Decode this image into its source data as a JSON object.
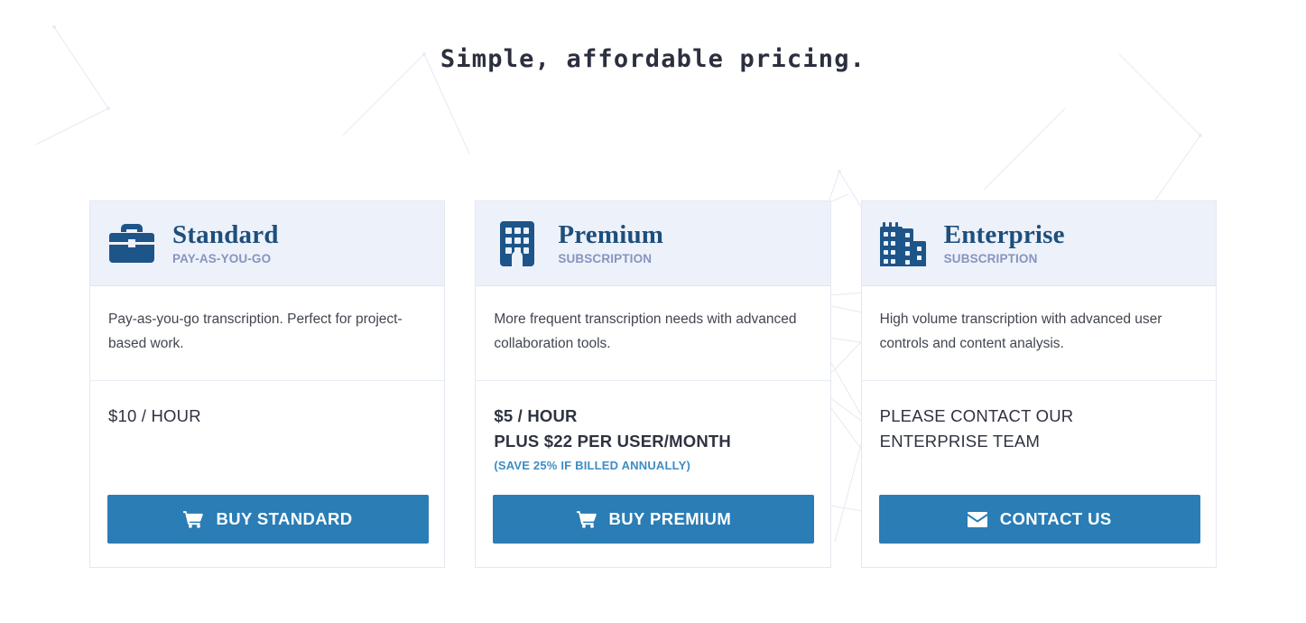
{
  "page": {
    "title": "Simple, affordable pricing.",
    "accent_color": "#2a7db5",
    "header_bg": "#edf1fa",
    "plan_name_color": "#1d4f7c",
    "note_color": "#3d8dc4"
  },
  "plans": [
    {
      "icon": "briefcase-icon",
      "name": "Standard",
      "kicker": "PAY-AS-YOU-GO",
      "description": "Pay-as-you-go transcription. Perfect for project-based work.",
      "price_lines": [
        "$10 / HOUR"
      ],
      "price_note": "",
      "cta_label": "BUY STANDARD",
      "cta_icon": "shopping-cart-icon"
    },
    {
      "icon": "building-icon",
      "name": "Premium",
      "kicker": "SUBSCRIPTION",
      "description": "More frequent transcription needs with advanced collaboration tools.",
      "price_lines": [
        "$5 / HOUR",
        "PLUS $22 PER USER/MONTH"
      ],
      "price_note": "(SAVE 25% IF BILLED ANNUALLY)",
      "cta_label": "BUY PREMIUM",
      "cta_icon": "shopping-cart-icon"
    },
    {
      "icon": "city-icon",
      "name": "Enterprise",
      "kicker": "SUBSCRIPTION",
      "description": "High volume transcription with advanced user controls and content analysis.",
      "price_lines": [
        "PLEASE CONTACT OUR ENTERPRISE TEAM"
      ],
      "price_note": "",
      "cta_label": "CONTACT US",
      "cta_icon": "envelope-icon"
    }
  ]
}
